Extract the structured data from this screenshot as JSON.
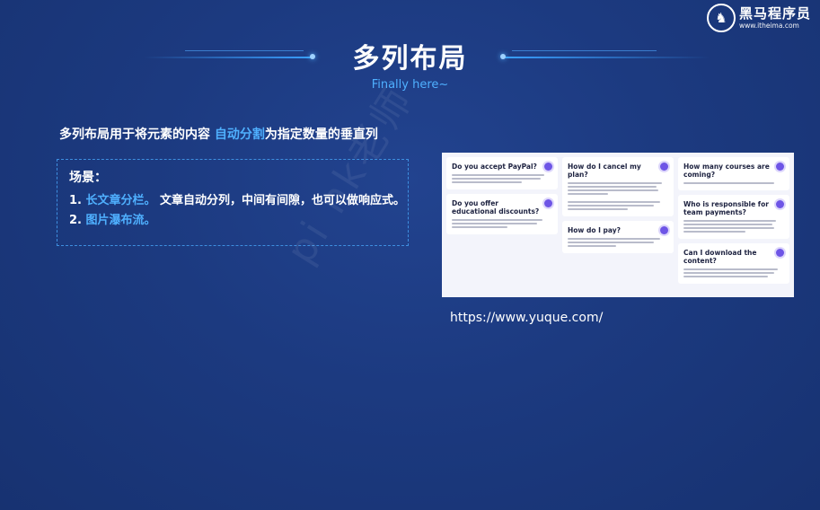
{
  "logo": {
    "mark": "♞",
    "name": "黑马程序员",
    "url": "www.itheima.com"
  },
  "slide": {
    "title": "多列布局",
    "subtitle": "Finally here~"
  },
  "description": {
    "prefix": "多列布局用于将元素的内容 ",
    "highlight": "自动分割",
    "suffix": "为指定数量的垂直列"
  },
  "scenario": {
    "heading": "场景：",
    "items": [
      {
        "number": "1. ",
        "highlight": "长文章分栏。",
        "text": " 文章自动分列，中间有间隙，也可以做响应式。"
      },
      {
        "number": "2. ",
        "highlight": "图片瀑布流。",
        "text": ""
      }
    ]
  },
  "screenshot": {
    "cards": [
      "Do you accept PayPal?",
      "Do you offer educational discounts?",
      "How do I cancel my plan?",
      "How do I pay?",
      "How many courses are coming?",
      "Who is responsible for team payments?",
      "Can I download the content?"
    ]
  },
  "link": {
    "url": "https://www.yuque.com/"
  },
  "watermark": {
    "text": "pi nk老师"
  },
  "colors": {
    "background": "#1c3a80",
    "accent": "#4fb0ff",
    "card_icon": "#6e55e6"
  }
}
